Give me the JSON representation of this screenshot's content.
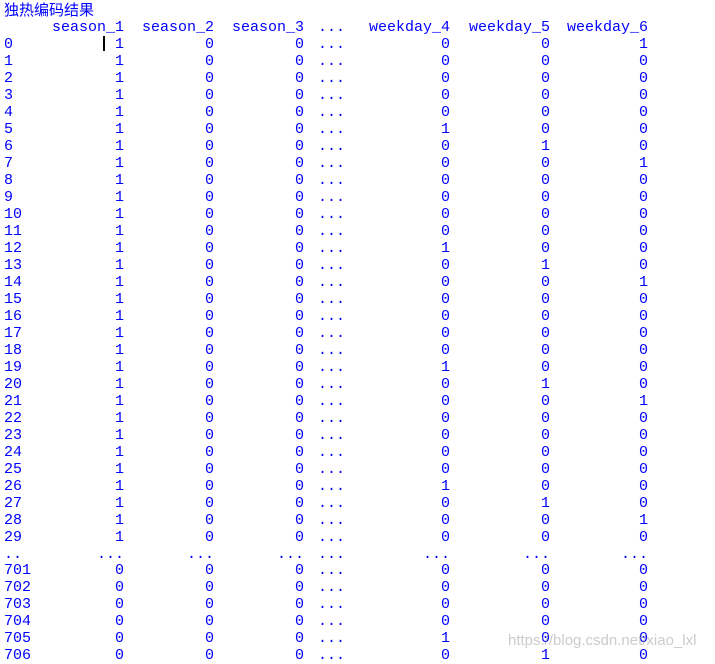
{
  "title": "独热编码结果",
  "columns": [
    "",
    "season_1",
    "season_2",
    "season_3",
    "...",
    "weekday_4",
    "weekday_5",
    "weekday_6"
  ],
  "rows": [
    [
      "0",
      "1",
      "0",
      "0",
      "...",
      "0",
      "0",
      "1"
    ],
    [
      "1",
      "1",
      "0",
      "0",
      "...",
      "0",
      "0",
      "0"
    ],
    [
      "2",
      "1",
      "0",
      "0",
      "...",
      "0",
      "0",
      "0"
    ],
    [
      "3",
      "1",
      "0",
      "0",
      "...",
      "0",
      "0",
      "0"
    ],
    [
      "4",
      "1",
      "0",
      "0",
      "...",
      "0",
      "0",
      "0"
    ],
    [
      "5",
      "1",
      "0",
      "0",
      "...",
      "1",
      "0",
      "0"
    ],
    [
      "6",
      "1",
      "0",
      "0",
      "...",
      "0",
      "1",
      "0"
    ],
    [
      "7",
      "1",
      "0",
      "0",
      "...",
      "0",
      "0",
      "1"
    ],
    [
      "8",
      "1",
      "0",
      "0",
      "...",
      "0",
      "0",
      "0"
    ],
    [
      "9",
      "1",
      "0",
      "0",
      "...",
      "0",
      "0",
      "0"
    ],
    [
      "10",
      "1",
      "0",
      "0",
      "...",
      "0",
      "0",
      "0"
    ],
    [
      "11",
      "1",
      "0",
      "0",
      "...",
      "0",
      "0",
      "0"
    ],
    [
      "12",
      "1",
      "0",
      "0",
      "...",
      "1",
      "0",
      "0"
    ],
    [
      "13",
      "1",
      "0",
      "0",
      "...",
      "0",
      "1",
      "0"
    ],
    [
      "14",
      "1",
      "0",
      "0",
      "...",
      "0",
      "0",
      "1"
    ],
    [
      "15",
      "1",
      "0",
      "0",
      "...",
      "0",
      "0",
      "0"
    ],
    [
      "16",
      "1",
      "0",
      "0",
      "...",
      "0",
      "0",
      "0"
    ],
    [
      "17",
      "1",
      "0",
      "0",
      "...",
      "0",
      "0",
      "0"
    ],
    [
      "18",
      "1",
      "0",
      "0",
      "...",
      "0",
      "0",
      "0"
    ],
    [
      "19",
      "1",
      "0",
      "0",
      "...",
      "1",
      "0",
      "0"
    ],
    [
      "20",
      "1",
      "0",
      "0",
      "...",
      "0",
      "1",
      "0"
    ],
    [
      "21",
      "1",
      "0",
      "0",
      "...",
      "0",
      "0",
      "1"
    ],
    [
      "22",
      "1",
      "0",
      "0",
      "...",
      "0",
      "0",
      "0"
    ],
    [
      "23",
      "1",
      "0",
      "0",
      "...",
      "0",
      "0",
      "0"
    ],
    [
      "24",
      "1",
      "0",
      "0",
      "...",
      "0",
      "0",
      "0"
    ],
    [
      "25",
      "1",
      "0",
      "0",
      "...",
      "0",
      "0",
      "0"
    ],
    [
      "26",
      "1",
      "0",
      "0",
      "...",
      "1",
      "0",
      "0"
    ],
    [
      "27",
      "1",
      "0",
      "0",
      "...",
      "0",
      "1",
      "0"
    ],
    [
      "28",
      "1",
      "0",
      "0",
      "...",
      "0",
      "0",
      "1"
    ],
    [
      "29",
      "1",
      "0",
      "0",
      "...",
      "0",
      "0",
      "0"
    ],
    [
      "..",
      "...",
      "...",
      "...",
      "...",
      "...",
      "...",
      "..."
    ],
    [
      "701",
      "0",
      "0",
      "0",
      "...",
      "0",
      "0",
      "0"
    ],
    [
      "702",
      "0",
      "0",
      "0",
      "...",
      "0",
      "0",
      "0"
    ],
    [
      "703",
      "0",
      "0",
      "0",
      "...",
      "0",
      "0",
      "0"
    ],
    [
      "704",
      "0",
      "0",
      "0",
      "...",
      "0",
      "0",
      "0"
    ],
    [
      "705",
      "0",
      "0",
      "0",
      "...",
      "1",
      "0",
      "0"
    ],
    [
      "706",
      "0",
      "0",
      "0",
      "...",
      "0",
      "1",
      "0"
    ]
  ],
  "watermark": "https://blog.csdn.net/xiao_lxl",
  "colors": {
    "text": "#0000ff",
    "cursor": "#000000",
    "background": "#ffffff"
  }
}
